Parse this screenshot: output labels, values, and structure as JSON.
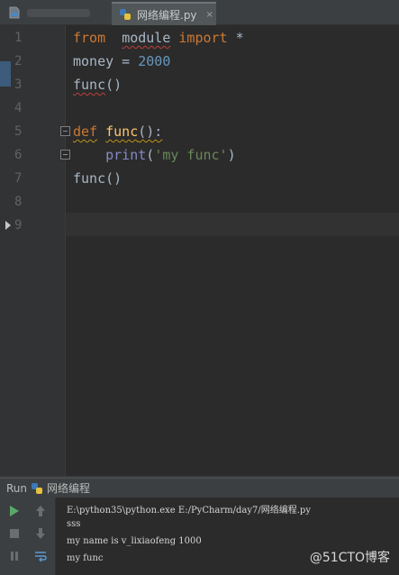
{
  "editor_tab": {
    "label": "网络编程.py",
    "close": "×"
  },
  "line_numbers": [
    "1",
    "2",
    "3",
    "4",
    "5",
    "6",
    "7",
    "8",
    "9"
  ],
  "code_lines": [
    [
      {
        "t": "from",
        "c": "kw"
      },
      {
        "t": "  ",
        "c": "plain"
      },
      {
        "t": "module",
        "c": "plain squiggle"
      },
      {
        "t": " ",
        "c": "plain"
      },
      {
        "t": "import",
        "c": "kw"
      },
      {
        "t": " *",
        "c": "plain"
      }
    ],
    [
      {
        "t": "money",
        "c": "plain"
      },
      {
        "t": " = ",
        "c": "plain"
      },
      {
        "t": "2000",
        "c": "num"
      }
    ],
    [
      {
        "t": "func",
        "c": "plain squiggle"
      },
      {
        "t": "()",
        "c": "plain"
      }
    ],
    [],
    [
      {
        "t": "def",
        "c": "kw squiggle-y"
      },
      {
        "t": " ",
        "c": "plain"
      },
      {
        "t": "func",
        "c": "fn squiggle-y"
      },
      {
        "t": "():",
        "c": "plain squiggle-y"
      }
    ],
    [
      {
        "t": "    ",
        "c": "plain"
      },
      {
        "t": "print",
        "c": "builtin"
      },
      {
        "t": "(",
        "c": "plain"
      },
      {
        "t": "'my func'",
        "c": "str"
      },
      {
        "t": ")",
        "c": "plain"
      }
    ],
    [
      {
        "t": "func",
        "c": "plain"
      },
      {
        "t": "()",
        "c": "plain"
      }
    ],
    [],
    []
  ],
  "run_panel": {
    "title": "Run",
    "config_name": "网络编程"
  },
  "console_lines": [
    "E:\\python35\\python.exe E:/PyCharm/day7/网络编程.py",
    "sss",
    "my name is v_lixiaofeng 1000",
    "my func"
  ],
  "watermark": "@51CTO博客",
  "icons": {
    "file": "python-file-icon",
    "run": "play-icon",
    "stop": "stop-icon",
    "pause": "pause-icon",
    "up": "up-arrow-icon",
    "down": "down-arrow-icon",
    "wrap": "soft-wrap-icon"
  },
  "colors": {
    "keyword": "#cc7832",
    "number": "#6897bb",
    "string": "#6a8759",
    "builtin": "#8888c6",
    "function": "#ffc66d",
    "run_green": "#59a869"
  }
}
